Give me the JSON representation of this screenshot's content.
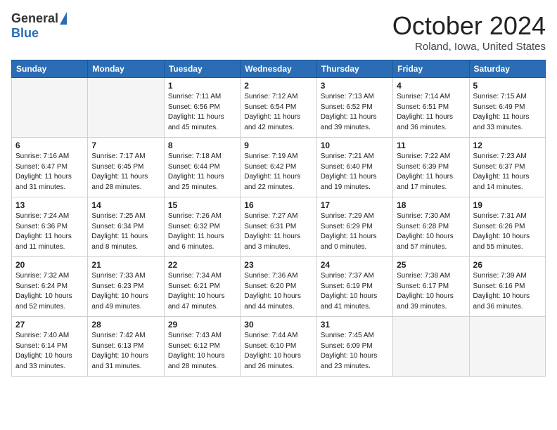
{
  "header": {
    "logo_general": "General",
    "logo_blue": "Blue",
    "month_title": "October 2024",
    "location": "Roland, Iowa, United States"
  },
  "days_of_week": [
    "Sunday",
    "Monday",
    "Tuesday",
    "Wednesday",
    "Thursday",
    "Friday",
    "Saturday"
  ],
  "weeks": [
    [
      {
        "day": "",
        "info": ""
      },
      {
        "day": "",
        "info": ""
      },
      {
        "day": "1",
        "info": "Sunrise: 7:11 AM\nSunset: 6:56 PM\nDaylight: 11 hours and 45 minutes."
      },
      {
        "day": "2",
        "info": "Sunrise: 7:12 AM\nSunset: 6:54 PM\nDaylight: 11 hours and 42 minutes."
      },
      {
        "day": "3",
        "info": "Sunrise: 7:13 AM\nSunset: 6:52 PM\nDaylight: 11 hours and 39 minutes."
      },
      {
        "day": "4",
        "info": "Sunrise: 7:14 AM\nSunset: 6:51 PM\nDaylight: 11 hours and 36 minutes."
      },
      {
        "day": "5",
        "info": "Sunrise: 7:15 AM\nSunset: 6:49 PM\nDaylight: 11 hours and 33 minutes."
      }
    ],
    [
      {
        "day": "6",
        "info": "Sunrise: 7:16 AM\nSunset: 6:47 PM\nDaylight: 11 hours and 31 minutes."
      },
      {
        "day": "7",
        "info": "Sunrise: 7:17 AM\nSunset: 6:45 PM\nDaylight: 11 hours and 28 minutes."
      },
      {
        "day": "8",
        "info": "Sunrise: 7:18 AM\nSunset: 6:44 PM\nDaylight: 11 hours and 25 minutes."
      },
      {
        "day": "9",
        "info": "Sunrise: 7:19 AM\nSunset: 6:42 PM\nDaylight: 11 hours and 22 minutes."
      },
      {
        "day": "10",
        "info": "Sunrise: 7:21 AM\nSunset: 6:40 PM\nDaylight: 11 hours and 19 minutes."
      },
      {
        "day": "11",
        "info": "Sunrise: 7:22 AM\nSunset: 6:39 PM\nDaylight: 11 hours and 17 minutes."
      },
      {
        "day": "12",
        "info": "Sunrise: 7:23 AM\nSunset: 6:37 PM\nDaylight: 11 hours and 14 minutes."
      }
    ],
    [
      {
        "day": "13",
        "info": "Sunrise: 7:24 AM\nSunset: 6:36 PM\nDaylight: 11 hours and 11 minutes."
      },
      {
        "day": "14",
        "info": "Sunrise: 7:25 AM\nSunset: 6:34 PM\nDaylight: 11 hours and 8 minutes."
      },
      {
        "day": "15",
        "info": "Sunrise: 7:26 AM\nSunset: 6:32 PM\nDaylight: 11 hours and 6 minutes."
      },
      {
        "day": "16",
        "info": "Sunrise: 7:27 AM\nSunset: 6:31 PM\nDaylight: 11 hours and 3 minutes."
      },
      {
        "day": "17",
        "info": "Sunrise: 7:29 AM\nSunset: 6:29 PM\nDaylight: 11 hours and 0 minutes."
      },
      {
        "day": "18",
        "info": "Sunrise: 7:30 AM\nSunset: 6:28 PM\nDaylight: 10 hours and 57 minutes."
      },
      {
        "day": "19",
        "info": "Sunrise: 7:31 AM\nSunset: 6:26 PM\nDaylight: 10 hours and 55 minutes."
      }
    ],
    [
      {
        "day": "20",
        "info": "Sunrise: 7:32 AM\nSunset: 6:24 PM\nDaylight: 10 hours and 52 minutes."
      },
      {
        "day": "21",
        "info": "Sunrise: 7:33 AM\nSunset: 6:23 PM\nDaylight: 10 hours and 49 minutes."
      },
      {
        "day": "22",
        "info": "Sunrise: 7:34 AM\nSunset: 6:21 PM\nDaylight: 10 hours and 47 minutes."
      },
      {
        "day": "23",
        "info": "Sunrise: 7:36 AM\nSunset: 6:20 PM\nDaylight: 10 hours and 44 minutes."
      },
      {
        "day": "24",
        "info": "Sunrise: 7:37 AM\nSunset: 6:19 PM\nDaylight: 10 hours and 41 minutes."
      },
      {
        "day": "25",
        "info": "Sunrise: 7:38 AM\nSunset: 6:17 PM\nDaylight: 10 hours and 39 minutes."
      },
      {
        "day": "26",
        "info": "Sunrise: 7:39 AM\nSunset: 6:16 PM\nDaylight: 10 hours and 36 minutes."
      }
    ],
    [
      {
        "day": "27",
        "info": "Sunrise: 7:40 AM\nSunset: 6:14 PM\nDaylight: 10 hours and 33 minutes."
      },
      {
        "day": "28",
        "info": "Sunrise: 7:42 AM\nSunset: 6:13 PM\nDaylight: 10 hours and 31 minutes."
      },
      {
        "day": "29",
        "info": "Sunrise: 7:43 AM\nSunset: 6:12 PM\nDaylight: 10 hours and 28 minutes."
      },
      {
        "day": "30",
        "info": "Sunrise: 7:44 AM\nSunset: 6:10 PM\nDaylight: 10 hours and 26 minutes."
      },
      {
        "day": "31",
        "info": "Sunrise: 7:45 AM\nSunset: 6:09 PM\nDaylight: 10 hours and 23 minutes."
      },
      {
        "day": "",
        "info": ""
      },
      {
        "day": "",
        "info": ""
      }
    ]
  ]
}
